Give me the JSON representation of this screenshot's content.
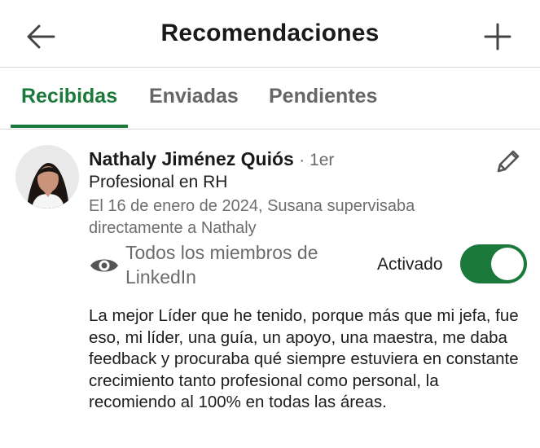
{
  "header": {
    "title": "Recomendaciones",
    "back_icon": "arrow-left-icon",
    "add_icon": "plus-icon"
  },
  "tabs": [
    {
      "label": "Recibidas",
      "active": true
    },
    {
      "label": "Enviadas",
      "active": false
    },
    {
      "label": "Pendientes",
      "active": false
    }
  ],
  "recommendation": {
    "name": "Nathaly Jiménez Quiós",
    "degree": "· 1er",
    "headline": "Profesional en RH",
    "meta": "El 16 de enero de 2024, Susana supervisaba directamente a Nathaly",
    "visibility": "Todos los miembros de LinkedIn",
    "toggle_label": "Activado",
    "toggle_on": true,
    "text": "La mejor Líder que he tenido, porque más que mi jefa, fue eso, mi líder, una guía, un apoyo, una maestra, me daba feedback y procuraba qué siempre estuviera en constante crecimiento tanto profesional como personal, la recomiendo al 100% en todas las áreas."
  },
  "colors": {
    "accent": "#1b7a3b",
    "muted_text": "#6b6b6b"
  }
}
